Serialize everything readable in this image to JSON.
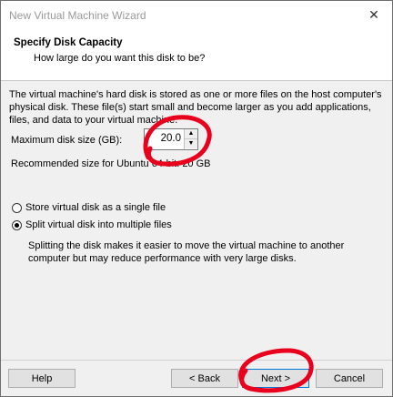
{
  "window": {
    "title": "New Virtual Machine Wizard",
    "close_glyph": "✕"
  },
  "header": {
    "title": "Specify Disk Capacity",
    "subtitle": "How large do you want this disk to be?"
  },
  "body": {
    "description": "The virtual machine's hard disk is stored as one or more files on the host computer's physical disk. These file(s) start small and become larger as you add applications, files, and data to your virtual machine.",
    "max_size_label": "Maximum disk size (GB):",
    "max_size_value": "20.0",
    "recommended": "Recommended size for Ubuntu 64-bit: 20 GB"
  },
  "options": {
    "single_file": {
      "label": "Store virtual disk as a single file",
      "checked": false
    },
    "multiple_files": {
      "label": "Split virtual disk into multiple files",
      "checked": true
    },
    "split_description": "Splitting the disk makes it easier to move the virtual machine to another computer but may reduce performance with very large disks."
  },
  "buttons": {
    "help": "Help",
    "back": "< Back",
    "next": "Next >",
    "cancel": "Cancel"
  },
  "icons": {
    "spin_up": "up-arrow-icon",
    "spin_down": "down-arrow-icon",
    "close": "close-icon"
  },
  "colors": {
    "annotation": "#e8001c",
    "focus": "#0078d7"
  }
}
